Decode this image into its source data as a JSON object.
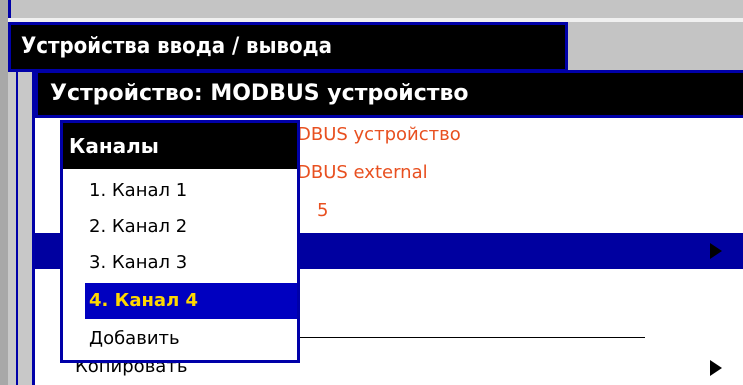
{
  "windows": {
    "io_devices": {
      "title": "Устройства ввода / вывода"
    },
    "device": {
      "title": "Устройство: MODBUS устройство",
      "fields": [
        {
          "partial_value": "DBUS устройство"
        },
        {
          "partial_value": "DBUS external"
        },
        {
          "partial_value": "5"
        }
      ],
      "copy_label": "Копировать"
    },
    "channels_popup": {
      "title": "Каналы",
      "items": [
        {
          "label": "1. Канал 1"
        },
        {
          "label": "2. Канал 2"
        },
        {
          "label": "3. Канал 3"
        },
        {
          "label": "4. Канал 4",
          "selected": true
        },
        {
          "label": "Добавить"
        }
      ]
    }
  },
  "colors": {
    "window_border": "#0000a8",
    "title_bg": "#000000",
    "selection_bg": "#0000c0",
    "selected_text": "#ffd800",
    "value_text": "#e85020"
  }
}
